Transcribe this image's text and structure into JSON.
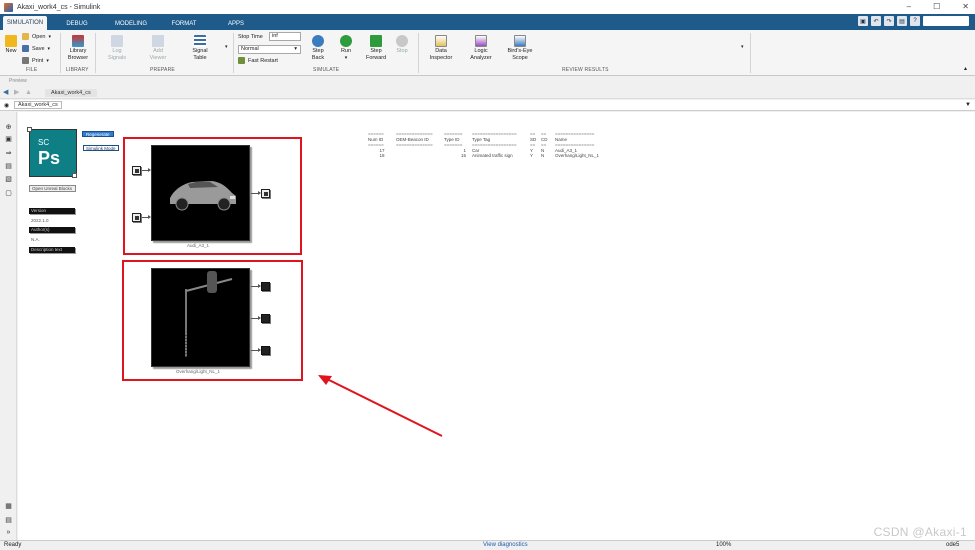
{
  "window": {
    "title": "Akaxi_work4_cs - Simulink",
    "controls": [
      "–",
      "☐",
      "✕"
    ]
  },
  "tabs": [
    {
      "label": "SIMULATION",
      "active": true
    },
    {
      "label": "DEBUG"
    },
    {
      "label": "MODELING"
    },
    {
      "label": "FORMAT"
    },
    {
      "label": "APPS"
    }
  ],
  "ribbon": {
    "file": {
      "new": "New",
      "open": "Open",
      "save": "Save",
      "print": "Print",
      "section": "FILE"
    },
    "library": {
      "browser": "Library Browser",
      "section": "LIBRARY"
    },
    "prepare": {
      "log_signals": "Log Signals",
      "add_viewer": "Add Viewer",
      "signal_table": "Signal Table",
      "section": "PREPARE"
    },
    "simulate": {
      "stop_time_label": "Stop Time",
      "stop_time_value": "inf",
      "mode": "Normal",
      "fast_restart": "Fast Restart",
      "step_back": "Step Back",
      "run": "Run",
      "step_forward": "Step Forward",
      "stop": "Stop",
      "section": "SIMULATE"
    },
    "review": {
      "data_inspector": "Data Inspector",
      "logic_analyzer": "Logic Analyzer",
      "birds_eye": "Bird's-Eye Scope",
      "section": "REVIEW RESULTS"
    }
  },
  "hint": "Preview",
  "breadcrumb": "Akaxi_work4_cs",
  "address": "Akaxi_work4_cs",
  "canvas": {
    "regenerate": "Regenerate",
    "simulink_mode": "Simulink Mode",
    "open_unreal": "Open Unreal Blocks",
    "version_label": "Version",
    "version_value": "2022.1.0",
    "authors_label": "Author(s)",
    "authors_value": "N.A.",
    "description_label": "Description text",
    "block1_caption": "Audi_A3_1",
    "block2_caption": "Overhang/Light_NL_1"
  },
  "table": {
    "sep": [
      "======",
      "==============",
      "=======",
      "=================",
      "==",
      "==",
      "==============="
    ],
    "headers": [
      "Num ID",
      "OEM-Beacon ID",
      "Type ID",
      "Type Tag",
      "SD",
      "CD",
      "Name"
    ],
    "rows": [
      [
        "17",
        "",
        "1",
        "Car",
        "Y",
        "N",
        "Audi_A3_1"
      ],
      [
        "18",
        "",
        "15",
        "Animated traffic sign",
        "Y",
        "N",
        "Overhang/Light_NL_1"
      ]
    ]
  },
  "status": {
    "left": "Ready",
    "diagnostics": "View diagnostics",
    "zoom": "100%",
    "solver": "ode5"
  },
  "watermark": "CSDN @Akaxi-1",
  "colors": {
    "tabbar": "#1e5a8a",
    "highlight": "#e0141e",
    "logo": "#0f7f86"
  }
}
